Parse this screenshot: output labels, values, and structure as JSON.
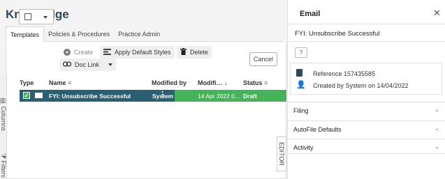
{
  "app": {
    "title": "Knowledge"
  },
  "tabs": [
    {
      "label": "Templates",
      "active": true
    },
    {
      "label": "Policies & Procedures",
      "active": false
    },
    {
      "label": "Practice Admin",
      "active": false
    }
  ],
  "toolbar": {
    "create_label": "Create",
    "apply_styles_label": "Apply Default Styles",
    "delete_label": "Delete",
    "doc_link_label": "Doc Link",
    "cancel_label": "Cancel"
  },
  "grid": {
    "columns": [
      "Type",
      "Name",
      "Modified by",
      "Modifi…",
      "Status"
    ],
    "rows": [
      {
        "name": "FYI: Unsubscribe Successful",
        "modified_by": "System",
        "modified": "14 Apr 2022 0…",
        "status": "Draft"
      }
    ]
  },
  "side_tabs": {
    "columns": "Columns",
    "filters": "Filters",
    "editor": "EDITOR"
  },
  "email_panel": {
    "title": "Email",
    "close": "✕",
    "subject": "FYI: Unsubscribe Successful",
    "help": "?",
    "reference": "Reference 157435585",
    "created": "Created by System on 14/04/2022",
    "sections": [
      "Filing",
      "AutoFile Defaults",
      "Activity"
    ]
  },
  "colors": {
    "accent_green": "#2f8a3e",
    "dark_teal": "#2a5f71",
    "brand": "#2d4a5c"
  }
}
